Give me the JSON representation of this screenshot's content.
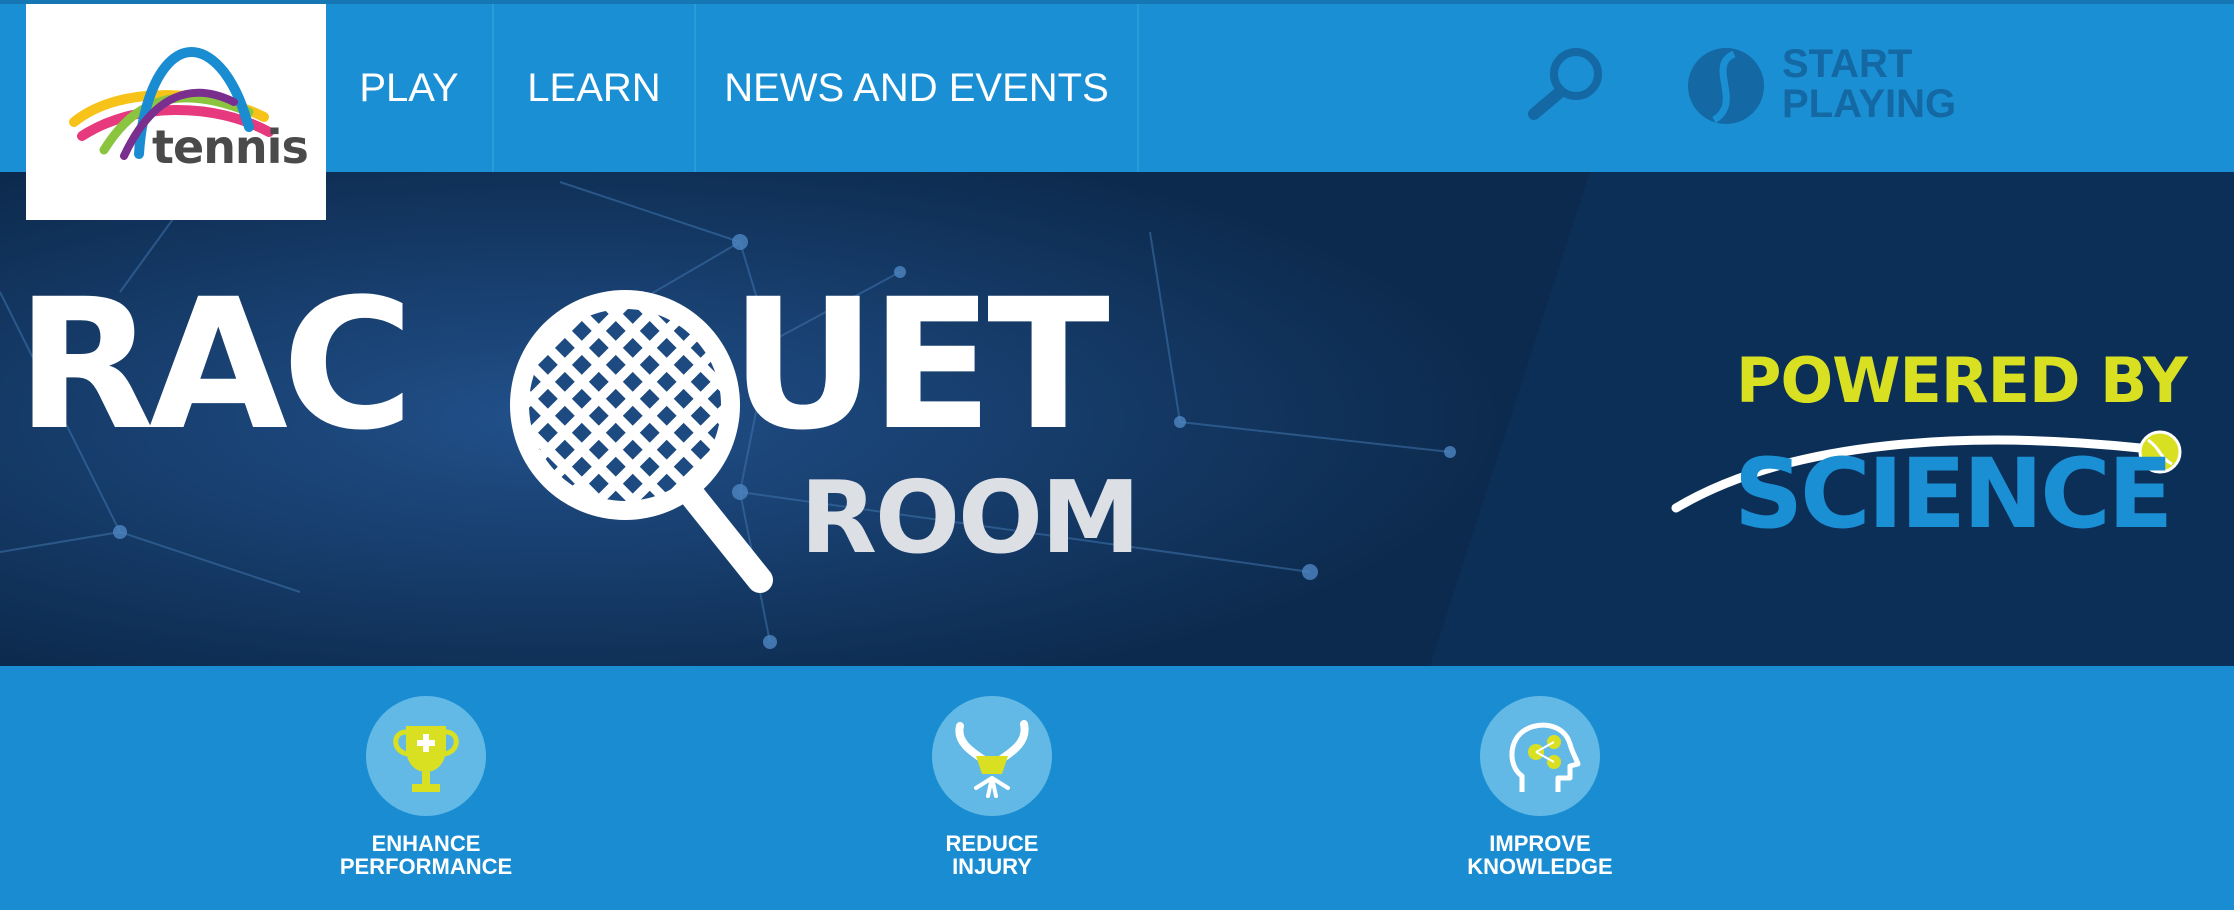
{
  "brand": {
    "logo_text": "tennis"
  },
  "nav": {
    "items": [
      {
        "label": "PLAY"
      },
      {
        "label": "LEARN"
      },
      {
        "label": "NEWS AND EVENTS"
      }
    ],
    "start_playing": {
      "line1": "START",
      "line2": "PLAYING"
    }
  },
  "hero": {
    "title_left": "RAC",
    "title_right": "UET",
    "subtitle": "ROOM",
    "powered_by": "POWERED BY",
    "science": "SCIENCE"
  },
  "features": [
    {
      "icon": "trophy-icon",
      "line1": "ENHANCE",
      "line2": "PERFORMANCE"
    },
    {
      "icon": "bandaged-arm-icon",
      "line1": "REDUCE",
      "line2": "INJURY"
    },
    {
      "icon": "head-brain-icon",
      "line1": "IMPROVE",
      "line2": "KNOWLEDGE"
    }
  ],
  "colors": {
    "nav_blue": "#1b8fd3",
    "hero_navy": "#0b2748",
    "accent_yellow": "#d9e022",
    "icon_circle": "#63b9e6"
  }
}
